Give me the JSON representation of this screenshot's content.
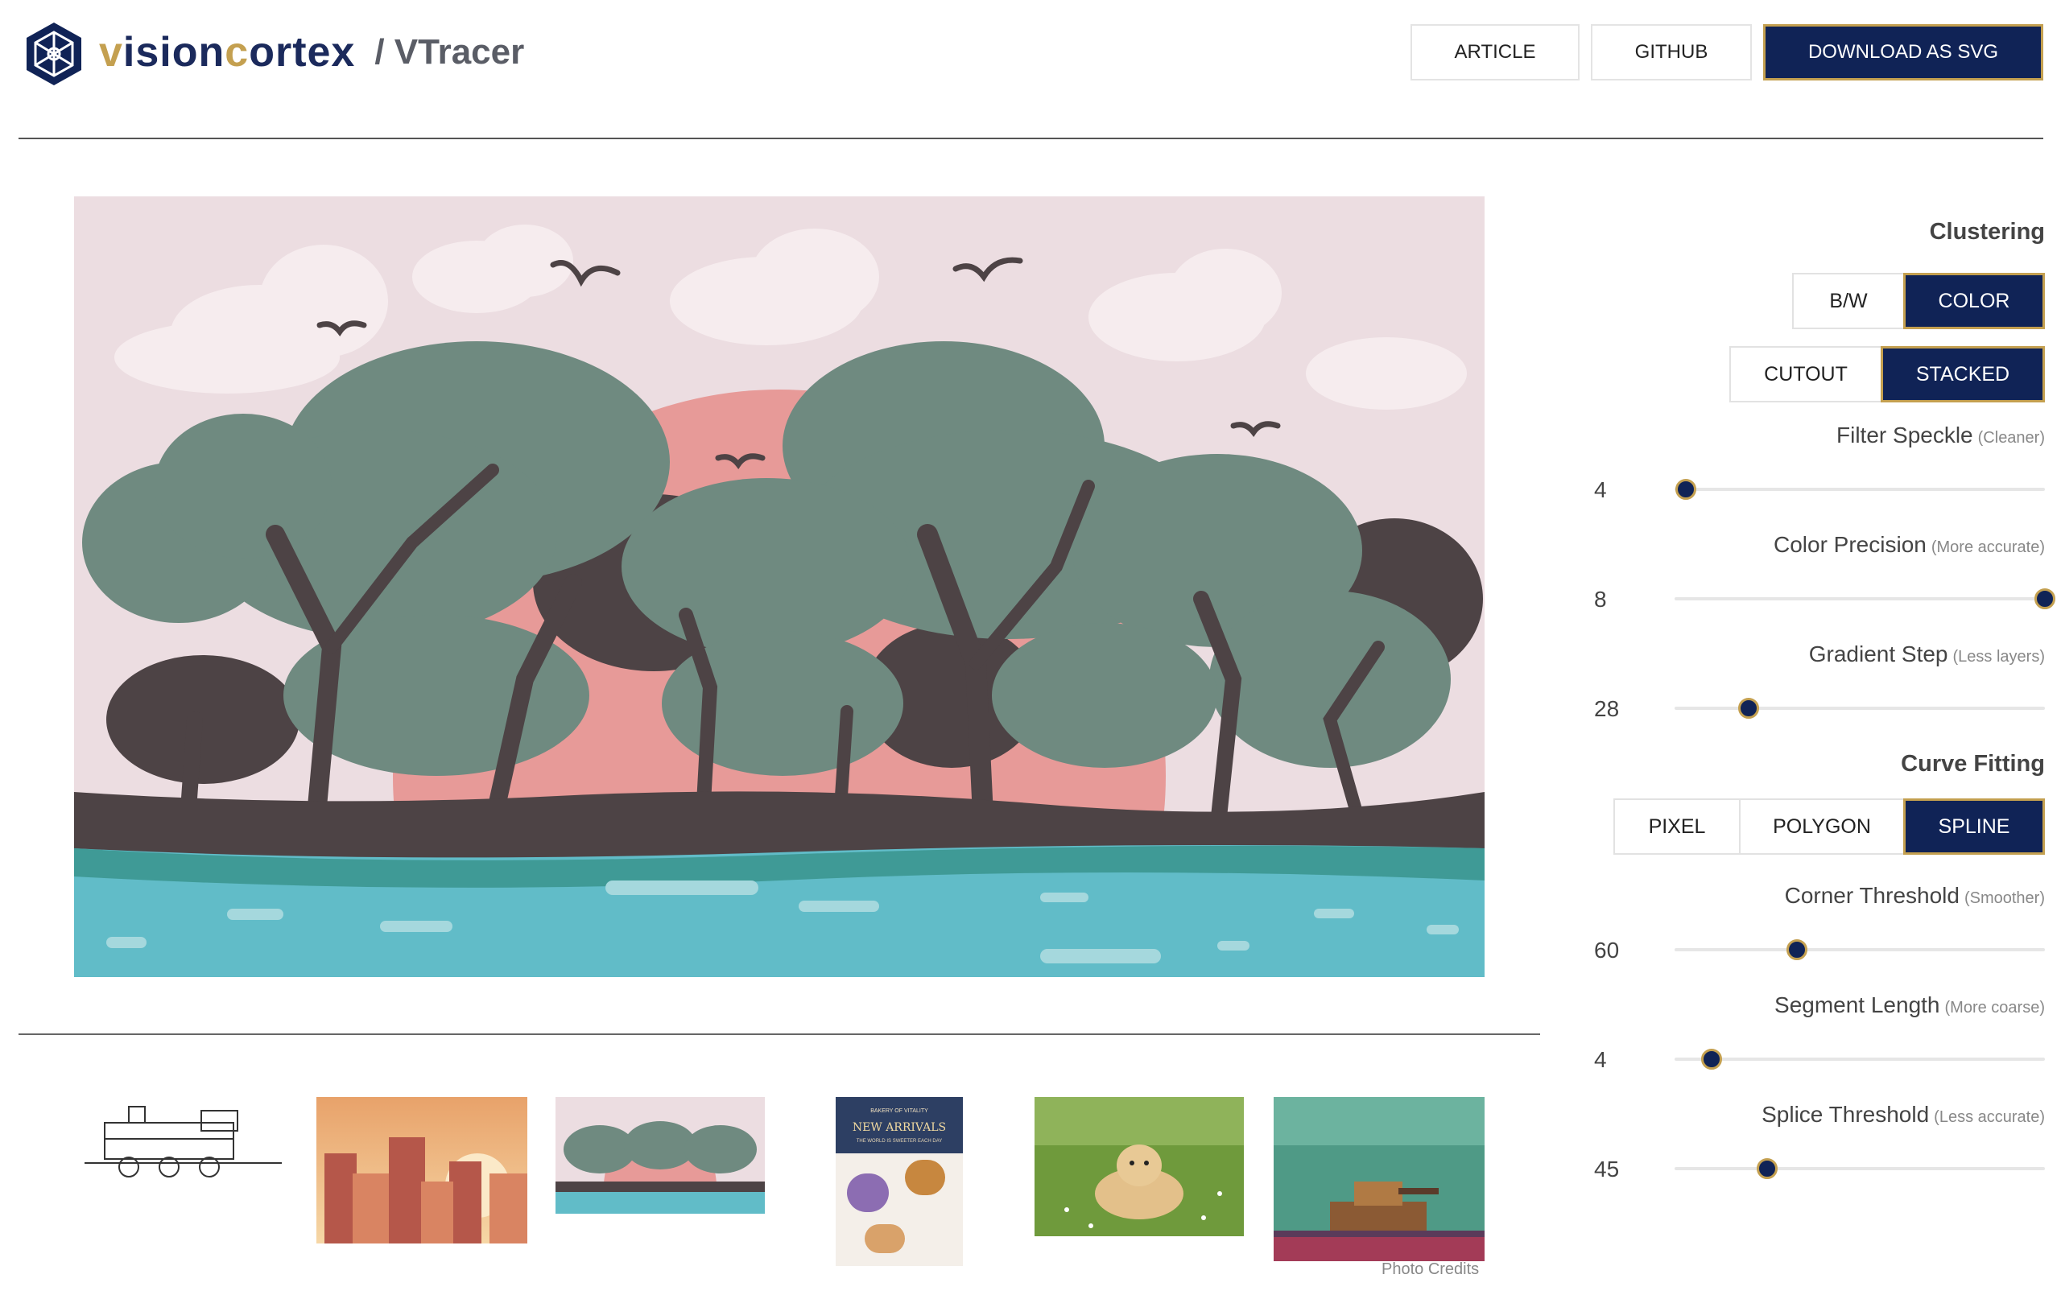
{
  "brand": {
    "name_part1": "v",
    "name_part2": "ision",
    "name_part3": "c",
    "name_part4": "ortex",
    "product": "/ VTracer"
  },
  "nav": {
    "article": "ARTICLE",
    "github": "GITHUB",
    "download": "DOWNLOAD AS SVG"
  },
  "controls": {
    "clustering_title": "Clustering",
    "color_mode": {
      "options": [
        "B/W",
        "COLOR"
      ],
      "selected": "COLOR"
    },
    "hierarchy": {
      "options": [
        "CUTOUT",
        "STACKED"
      ],
      "selected": "STACKED"
    },
    "filter_speckle": {
      "label": "Filter Speckle",
      "hint": "(Cleaner)",
      "value": "4",
      "level": 0.03
    },
    "color_precision": {
      "label": "Color Precision",
      "hint": "(More accurate)",
      "value": "8",
      "level": 1.0
    },
    "gradient_step": {
      "label": "Gradient Step",
      "hint": "(Less layers)",
      "value": "28",
      "level": 0.2
    },
    "curve_fitting_title": "Curve Fitting",
    "curve_mode": {
      "options": [
        "PIXEL",
        "POLYGON",
        "SPLINE"
      ],
      "selected": "SPLINE"
    },
    "corner_threshold": {
      "label": "Corner Threshold",
      "hint": "(Smoother)",
      "value": "60",
      "level": 0.33
    },
    "segment_length": {
      "label": "Segment Length",
      "hint": "(More coarse)",
      "value": "4",
      "level": 0.1
    },
    "splice_threshold": {
      "label": "Splice Threshold",
      "hint": "(Less accurate)",
      "value": "45",
      "level": 0.25
    }
  },
  "gallery": {
    "items": [
      "locomotive-sketch",
      "city-sunset",
      "forest-lake",
      "bakery-flyer",
      "golden-retriever",
      "pixel-tank"
    ],
    "credits": "Photo Credits",
    "flyer_top": "BAKERY OF VITALITY",
    "flyer_title": "NEW ARRIVALS",
    "flyer_sub": "THE WORLD IS SWEETER EACH DAY"
  },
  "colors": {
    "navy": "#102356",
    "gold": "#c4a050",
    "sky": "#ecdde1",
    "sun": "#e79a98",
    "tree": "#6f8a80",
    "trunk": "#4d4345",
    "water": "#61bcc8"
  }
}
